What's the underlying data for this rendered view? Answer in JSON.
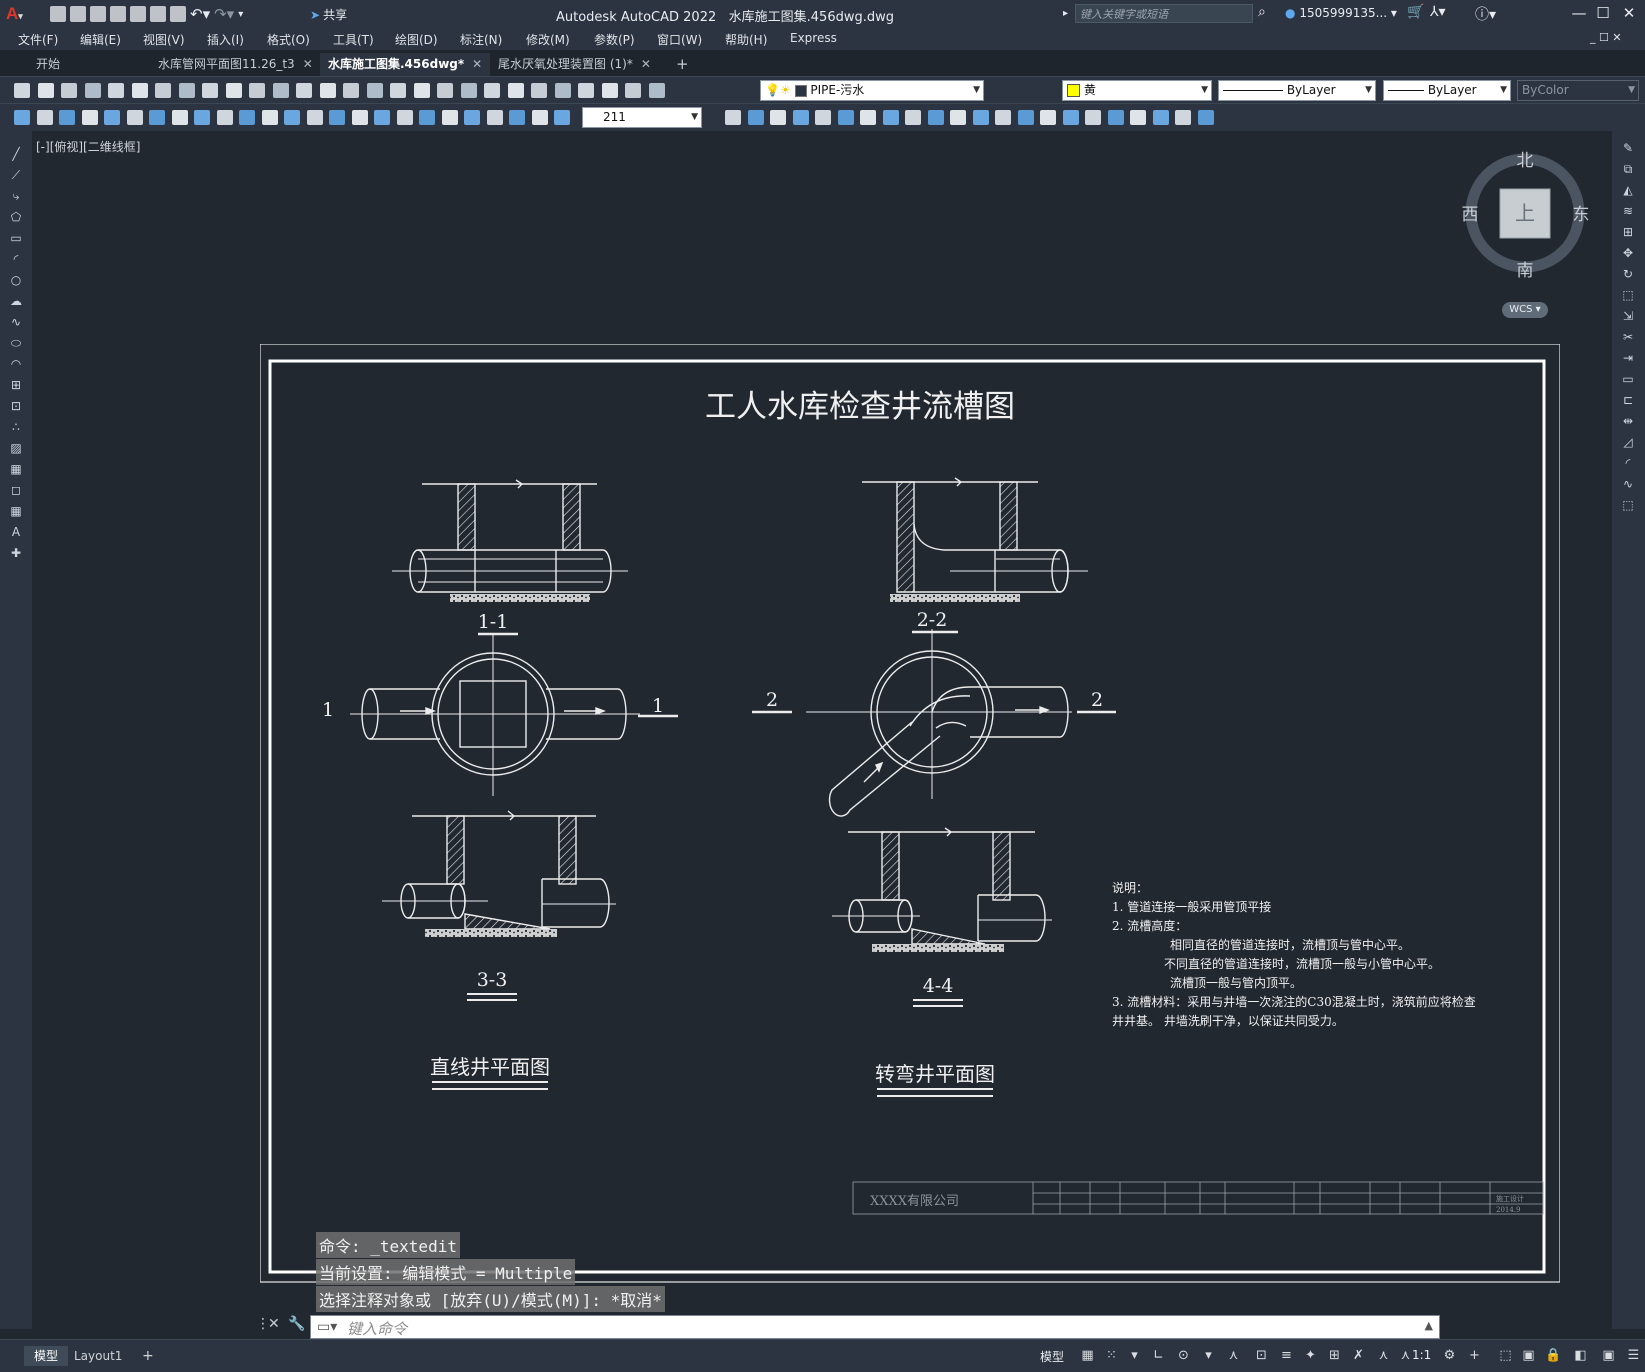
{
  "titlebar": {
    "app_title": "Autodesk AutoCAD 2022",
    "file_title": "水库施工图集.456dwg.dwg",
    "share_label": "共享",
    "search_placeholder": "键入关键字或短语",
    "user": "1505999135...",
    "icons": [
      "new-icon",
      "open-icon",
      "save-icon",
      "saveas-icon",
      "plot-icon",
      "publish-icon",
      "print-icon",
      "undo-icon",
      "redo-icon"
    ]
  },
  "menubar": {
    "items": [
      "文件(F)",
      "编辑(E)",
      "视图(V)",
      "插入(I)",
      "格式(O)",
      "工具(T)",
      "绘图(D)",
      "标注(N)",
      "修改(M)",
      "参数(P)",
      "窗口(W)",
      "帮助(H)",
      "Express"
    ]
  },
  "tabs": [
    {
      "label": "开始",
      "active": false,
      "closable": false
    },
    {
      "label": "水库管网平面图11.26_t3",
      "active": false,
      "closable": true
    },
    {
      "label": "水库施工图集.456dwg*",
      "active": true,
      "closable": true
    },
    {
      "label": "尾水厌氧处理装置图 (1)*",
      "active": false,
      "closable": true
    }
  ],
  "toolbar1": {
    "layer": "PIPE-污水",
    "color": "黄",
    "color_hex": "#ffff00",
    "linetype": "ByLayer",
    "lineweight": "ByLayer",
    "plotstyle": "ByColor"
  },
  "toolbar2": {
    "dimstyle_value": "211"
  },
  "viewport": {
    "label": "[-][俯视][二维线框]"
  },
  "viewcube": {
    "north": "北",
    "south": "南",
    "east": "东",
    "west": "西",
    "top": "上",
    "wcs": "WCS"
  },
  "drawing": {
    "title": "工人水库检查井流槽图",
    "section_1_1": "1-1",
    "section_2_2": "2-2",
    "section_3_3": "3-3",
    "section_4_4": "4-4",
    "mark_1": "1",
    "mark_2": "2",
    "caption_straight": "直线井平面图",
    "caption_bend": "转弯井平面图",
    "notes_title": "说明：",
    "notes": [
      "1. 管道连接一般采用管顶平接",
      "2. 流槽高度：",
      "相同直径的管道连接时，流槽顶与管中心平。",
      "不同直径的管道连接时，流槽顶一般与小管中心平。",
      "流槽顶一般与管内顶平。",
      "3. 流槽材料：采用与井墙一次浇注的C30混凝土时，浇筑前应将检查",
      "井井基。  井墙洗刷干净，以保证共同受力。"
    ],
    "company": "XXXX有限公司",
    "titleblock_date": "2014.9",
    "titleblock_scale": "施工设计"
  },
  "command": {
    "history": [
      "命令:  _textedit",
      "当前设置: 编辑模式 = Multiple",
      "选择注释对象或 [放弃(U)/模式(M)]: *取消*"
    ],
    "placeholder": "键入命令"
  },
  "statusbar": {
    "layout_tabs": [
      "模型",
      "Layout1"
    ],
    "model_label": "模型",
    "scale": "1:1"
  }
}
